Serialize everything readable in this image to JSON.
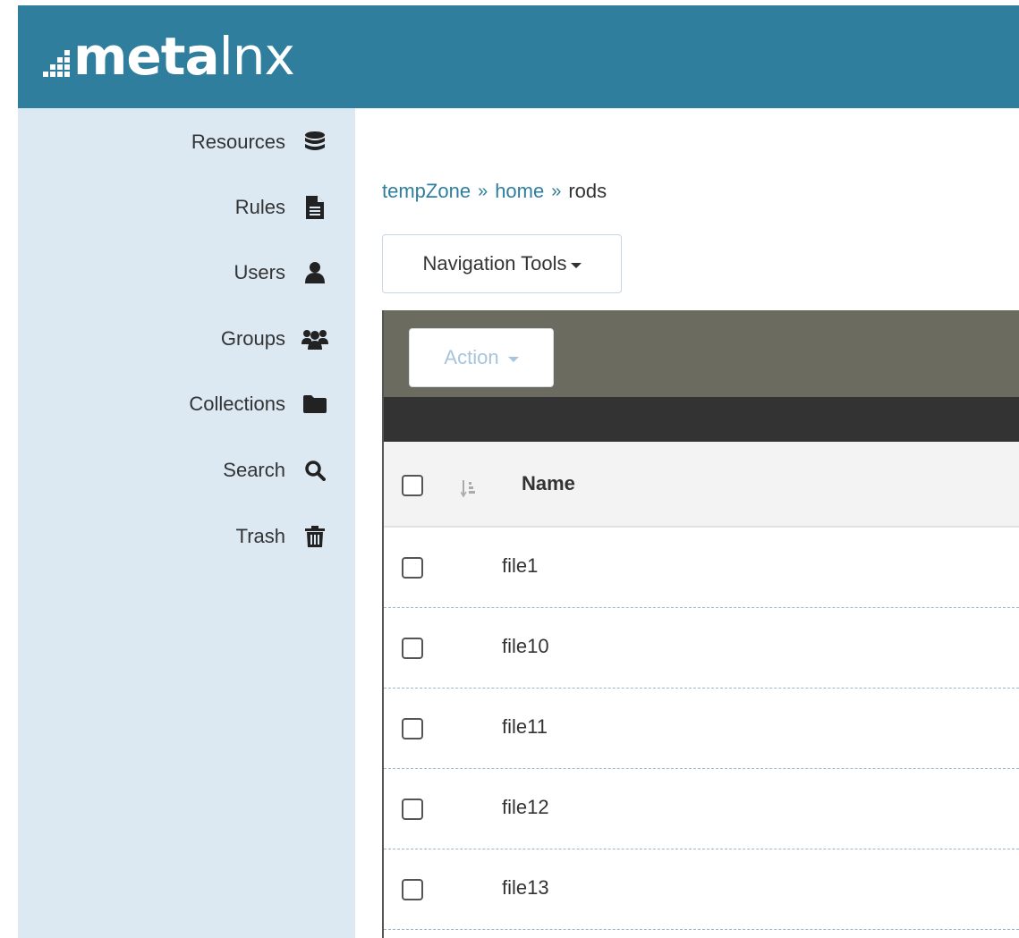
{
  "header": {
    "logo_bold": "meta",
    "logo_thin": "lnx",
    "background": "#2f7e9e"
  },
  "sidebar": {
    "items": [
      {
        "label": "Resources",
        "icon": "database-icon"
      },
      {
        "label": "Rules",
        "icon": "file-text-icon"
      },
      {
        "label": "Users",
        "icon": "user-icon"
      },
      {
        "label": "Groups",
        "icon": "users-group-icon"
      },
      {
        "label": "Collections",
        "icon": "folder-icon"
      },
      {
        "label": "Search",
        "icon": "search-icon"
      },
      {
        "label": "Trash",
        "icon": "trash-icon"
      }
    ]
  },
  "breadcrumb": {
    "items": [
      "tempZone",
      "home",
      "rods"
    ],
    "separator": "»"
  },
  "toolbar": {
    "nav_tools_label": "Navigation Tools",
    "action_label": "Action"
  },
  "table": {
    "columns": [
      "Name"
    ],
    "rows": [
      {
        "name": "file1"
      },
      {
        "name": "file10"
      },
      {
        "name": "file11"
      },
      {
        "name": "file12"
      },
      {
        "name": "file13"
      }
    ]
  }
}
